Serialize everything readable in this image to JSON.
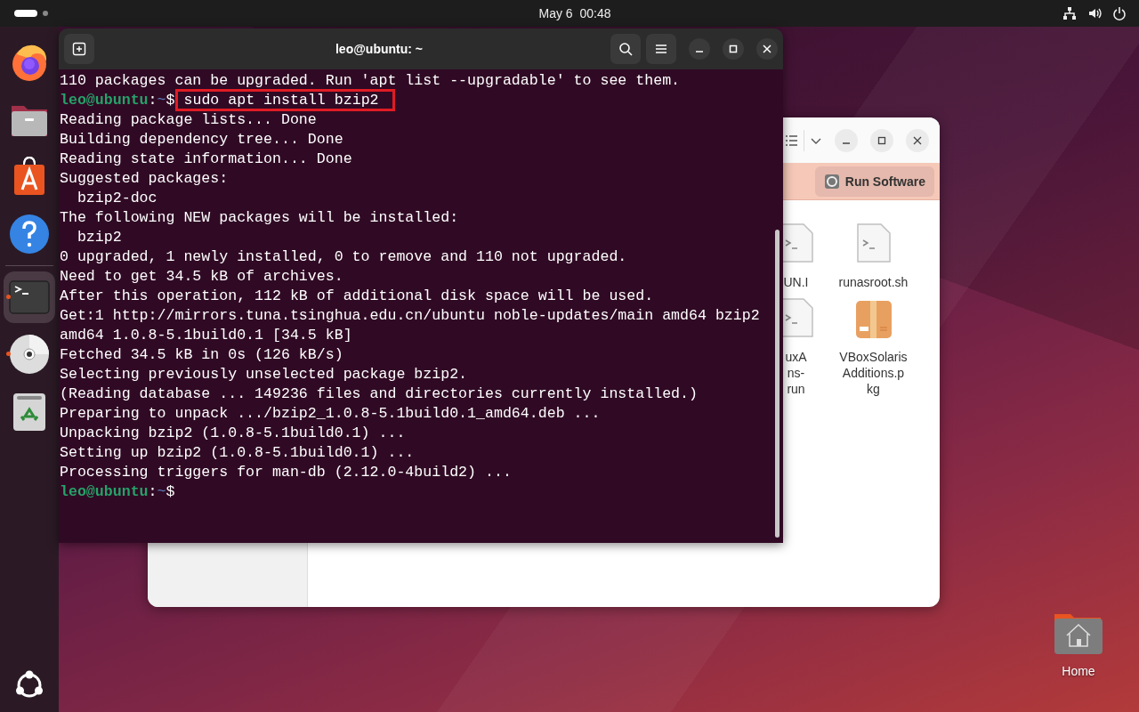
{
  "top_bar": {
    "clock": "May 6  00:48"
  },
  "dock": {
    "items": [
      {
        "kind": "browser",
        "running": false,
        "focused": false
      },
      {
        "kind": "files",
        "running": false,
        "focused": false
      },
      {
        "kind": "store",
        "running": false,
        "focused": false
      },
      {
        "kind": "help",
        "running": false,
        "focused": false
      },
      {
        "kind": "terminal",
        "running": true,
        "focused": true
      },
      {
        "kind": "disc",
        "running": true,
        "focused": false
      },
      {
        "kind": "trash",
        "running": false,
        "focused": false
      }
    ]
  },
  "files_window": {
    "banner_button": "Run Software",
    "files": [
      {
        "kind": "script",
        "label_lines": [
          "UN.I"
        ]
      },
      {
        "kind": "script",
        "label_lines": [
          "runasroot.sh"
        ]
      },
      {
        "kind": "script",
        "label_lines": [
          "uxA",
          "ns-",
          "run"
        ]
      },
      {
        "kind": "package",
        "label_lines": [
          "VBoxSolaris",
          "Additions.p",
          "kg"
        ]
      }
    ]
  },
  "terminal": {
    "title": "leo@ubuntu: ~",
    "lines": [
      {
        "kind": "output",
        "text": "110 packages can be upgraded. Run 'apt list --upgradable' to see them."
      },
      {
        "kind": "prompt",
        "user": "leo@ubuntu",
        "separator": ":",
        "path": "~",
        "symbol": "$",
        "command": "sudo apt install bzip2",
        "highlighted": true
      },
      {
        "kind": "output",
        "text": "Reading package lists... Done"
      },
      {
        "kind": "output",
        "text": "Building dependency tree... Done"
      },
      {
        "kind": "output",
        "text": "Reading state information... Done"
      },
      {
        "kind": "output",
        "text": "Suggested packages:"
      },
      {
        "kind": "output",
        "text": "  bzip2-doc"
      },
      {
        "kind": "output",
        "text": "The following NEW packages will be installed:"
      },
      {
        "kind": "output",
        "text": "  bzip2"
      },
      {
        "kind": "output",
        "text": "0 upgraded, 1 newly installed, 0 to remove and 110 not upgraded."
      },
      {
        "kind": "output",
        "text": "Need to get 34.5 kB of archives."
      },
      {
        "kind": "output",
        "text": "After this operation, 112 kB of additional disk space will be used."
      },
      {
        "kind": "output",
        "text": "Get:1 http://mirrors.tuna.tsinghua.edu.cn/ubuntu noble-updates/main amd64 bzip2"
      },
      {
        "kind": "output",
        "text": "amd64 1.0.8-5.1build0.1 [34.5 kB]"
      },
      {
        "kind": "output",
        "text": "Fetched 34.5 kB in 0s (126 kB/s)"
      },
      {
        "kind": "output",
        "text": "Selecting previously unselected package bzip2."
      },
      {
        "kind": "output",
        "text": "(Reading database ... 149236 files and directories currently installed.)"
      },
      {
        "kind": "output",
        "text": "Preparing to unpack .../bzip2_1.0.8-5.1build0.1_amd64.deb ..."
      },
      {
        "kind": "output",
        "text": "Unpacking bzip2 (1.0.8-5.1build0.1) ..."
      },
      {
        "kind": "output",
        "text": "Setting up bzip2 (1.0.8-5.1build0.1) ..."
      },
      {
        "kind": "output",
        "text": "Processing triggers for man-db (2.12.0-4build2) ..."
      },
      {
        "kind": "prompt",
        "user": "leo@ubuntu",
        "separator": ":",
        "path": "~",
        "symbol": "$"
      }
    ]
  },
  "desktop_icons": [
    {
      "label": "Home"
    }
  ]
}
